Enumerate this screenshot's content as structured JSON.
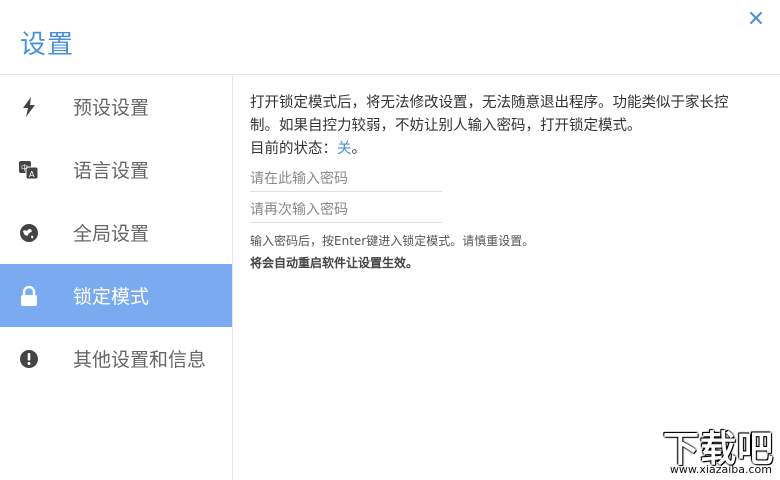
{
  "window": {
    "title": "设置",
    "close_icon": "close-icon"
  },
  "sidebar": {
    "items": [
      {
        "label": "预设设置",
        "icon": "bolt-icon"
      },
      {
        "label": "语言设置",
        "icon": "translate-icon"
      },
      {
        "label": "全局设置",
        "icon": "globe-icon"
      },
      {
        "label": "锁定模式",
        "icon": "lock-icon",
        "active": true
      },
      {
        "label": "其他设置和信息",
        "icon": "info-icon"
      }
    ]
  },
  "main": {
    "description": "打开锁定模式后，将无法修改设置，无法随意退出程序。功能类似于家长控制。如果自控力较弱，不妨让别人输入密码，打开锁定模式。",
    "status_label": "目前的状态：",
    "status_value": "关",
    "status_suffix": "。",
    "password_placeholder": "请在此输入密码",
    "password_confirm_placeholder": "请再次输入密码",
    "hint": "输入密码后，按Enter键进入锁定模式。请慎重设置。",
    "hint_bold": "将会自动重启软件让设置生效。"
  },
  "watermark": {
    "text": "下载吧",
    "url": "www.xiazaiba.com"
  },
  "colors": {
    "accent": "#4a90e2",
    "active_bg": "#7aaaf0"
  }
}
